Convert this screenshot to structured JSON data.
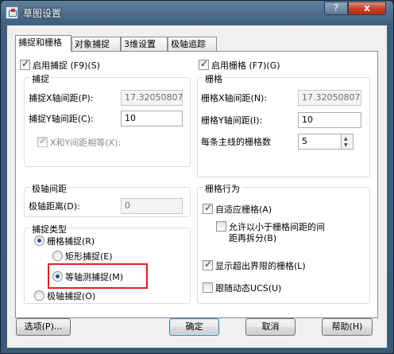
{
  "window": {
    "title": "草图设置",
    "help_label": "?",
    "close_label": "x"
  },
  "tabs": [
    {
      "label": "捕捉和栅格"
    },
    {
      "label": "对象捕捉"
    },
    {
      "label": "3维设置"
    },
    {
      "label": "极轴追踪"
    }
  ],
  "snap": {
    "enable_label": "启用捕捉 (F9)(S)",
    "enabled": true,
    "group_label": "捕捉",
    "x_spacing_label": "捕捉X轴间距(P):",
    "x_spacing_value": "17.32050807",
    "y_spacing_label": "捕捉Y轴间距(C):",
    "y_spacing_value": "10",
    "equal_xy_label": "X和Y间距相等(X):",
    "equal_xy_checked": true
  },
  "polar_spacing": {
    "group_label": "极轴间距",
    "distance_label": "极轴距离(D):",
    "distance_value": "0"
  },
  "snap_type": {
    "group_label": "捕捉类型",
    "grid_snap_label": "栅格捕捉(R)",
    "rect_snap_label": "矩形捕捉(E)",
    "iso_snap_label": "等轴测捕捉(M)",
    "polar_snap_label": "极轴捕捉(O)",
    "selected": "iso_snap"
  },
  "grid": {
    "enable_label": "启用栅格 (F7)(G)",
    "enabled": true,
    "group_label": "栅格",
    "x_spacing_label": "栅格X轴间距(N):",
    "x_spacing_value": "17.32050807",
    "y_spacing_label": "栅格Y轴间距(I):",
    "y_spacing_value": "10",
    "major_label": "每条主线的栅格数",
    "major_value": "5"
  },
  "grid_behavior": {
    "group_label": "栅格行为",
    "adaptive_label": "自适应栅格(A)",
    "adaptive_checked": true,
    "subdivide_line1": "允许以小于栅格间距的间",
    "subdivide_line2": "距再拆分(B)",
    "subdivide_checked": false,
    "beyond_limits_label": "显示超出界限的栅格(L)",
    "beyond_limits_checked": true,
    "follow_ucs_label": "跟随动态UCS(U)",
    "follow_ucs_checked": false
  },
  "buttons": {
    "options": "选项(P)...",
    "ok": "确定",
    "cancel": "取消",
    "help": "帮助(H)"
  },
  "colors": {
    "highlight": "#e02020",
    "title_bar": "#3d5f80"
  }
}
